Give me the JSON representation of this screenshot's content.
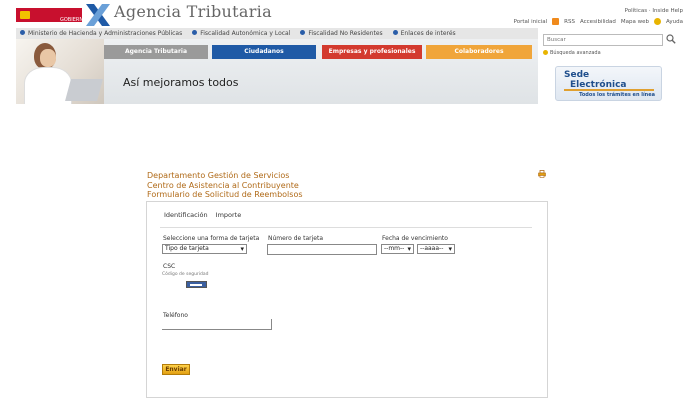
{
  "header": {
    "ministry_badge": "GOBIERNO DE ESPAÑA",
    "agency_name": "Agencia Tributaria",
    "languages": "Políticas · Inside Help",
    "top_links": [
      "Portal inicial",
      "RSS",
      "Accesibilidad",
      "Mapa web",
      "Ayuda"
    ]
  },
  "nav": {
    "links": [
      "Ministerio de Hacienda y Administraciones Públicas",
      "Fiscalidad Autonómica y Local",
      "Fiscalidad No Residentes",
      "Enlaces de interés"
    ],
    "tabs": [
      "Agencia Tributaria",
      "Ciudadanos",
      "Empresas y profesionales",
      "Colaboradores"
    ]
  },
  "banner": {
    "slogan": "Así mejoramos todos"
  },
  "search": {
    "placeholder": "Buscar",
    "advanced": "Búsqueda avanzada"
  },
  "sede": {
    "line1": "Sede",
    "line2": "Electrónica",
    "tagline": "Todos los trámites en línea"
  },
  "form": {
    "title_lines": [
      "Departamento Gestión de Servicios",
      "Centro de Asistencia al Contribuyente",
      "Formulario de Solicitud de Reembolsos"
    ],
    "tabs": [
      "Identificación",
      "Importe"
    ],
    "card_type_label": "Seleccione una forma de tarjeta",
    "card_type_value": "Tipo de tarjeta",
    "card_number_label": "Número de tarjeta",
    "expiry_label": "Fecha de vencimiento",
    "month_value": "--mm--",
    "year_value": "--aaaa--",
    "cvv_label": "CSC",
    "cvv_hint": "Código de seguridad",
    "phone_label": "Teléfono",
    "submit_label": "Enviar"
  },
  "colors": {
    "tab_agency": "#9a9a9a",
    "tab_citizens": "#1f5aa6",
    "tab_companies": "#d33a2f",
    "tab_collaborators": "#f0a53a",
    "title_brown": "#b06a18"
  }
}
